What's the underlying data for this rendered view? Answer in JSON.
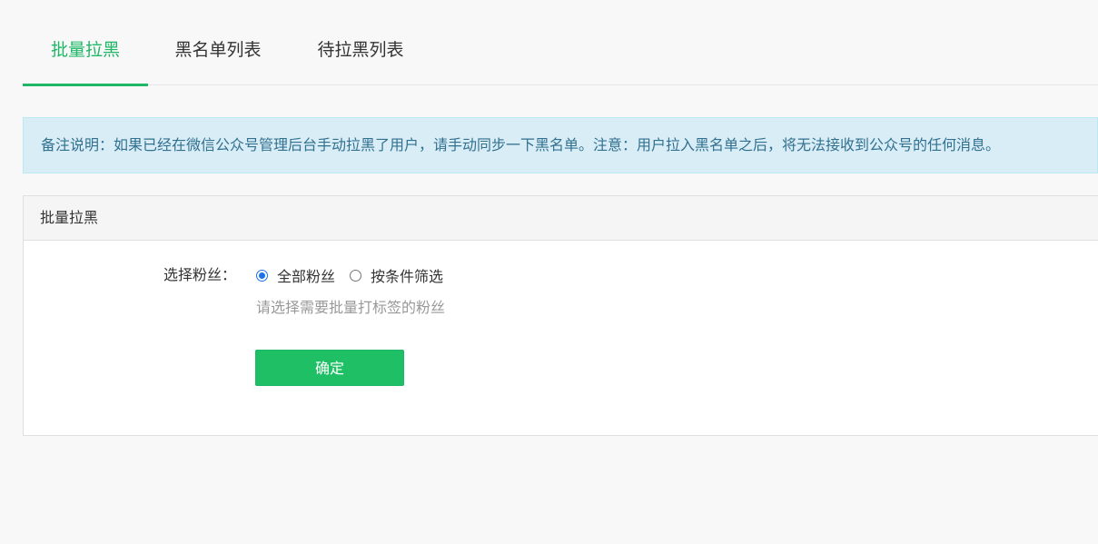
{
  "tabs": [
    {
      "label": "批量拉黑",
      "active": true
    },
    {
      "label": "黑名单列表",
      "active": false
    },
    {
      "label": "待拉黑列表",
      "active": false
    }
  ],
  "alert": {
    "text": "备注说明：如果已经在微信公众号管理后台手动拉黑了用户，请手动同步一下黑名单。注意：用户拉入黑名单之后，将无法接收到公众号的任何消息。"
  },
  "panel": {
    "title": "批量拉黑",
    "form": {
      "label": "选择粉丝：",
      "options": [
        {
          "label": "全部粉丝",
          "checked": true
        },
        {
          "label": "按条件筛选",
          "checked": false
        }
      ],
      "help": "请选择需要批量打标签的粉丝",
      "submit_label": "确定"
    }
  },
  "colors": {
    "accent": "#1db765",
    "alert_bg": "#d9edf7",
    "alert_text": "#31708f",
    "radio_checked": "#1a73e8"
  }
}
